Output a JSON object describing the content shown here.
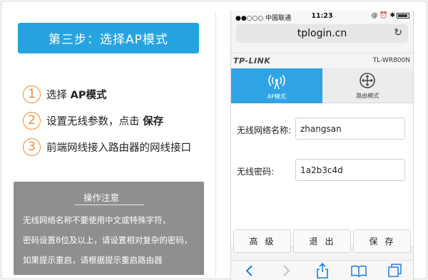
{
  "left": {
    "step_title": "第三步：选择AP模式",
    "steps": [
      {
        "num": "1",
        "text": "选择 ",
        "bold": "AP模式"
      },
      {
        "num": "2",
        "text": "设置无线参数，点击 ",
        "bold": "保存"
      },
      {
        "num": "3",
        "text": "前端网线接入路由器的网线接口",
        "bold": ""
      }
    ],
    "notice": {
      "title": "操作注意",
      "lines": [
        "无线网络名称不要使用中文或特殊字符，",
        "密码设置8位及以上，请设置相对复杂的密码，",
        "如果提示重启，请根据提示重启路由器"
      ]
    }
  },
  "phone": {
    "status": {
      "carrier": "●●○○○ 中国联通",
      "time": "11:23",
      "right": "@ ⏰ ✱"
    },
    "url": "tplogin.cn",
    "brand": "TP-LINK",
    "model": "TL-WR800N",
    "modes": [
      {
        "label": "AP模式",
        "icon": "wifi-signal-icon",
        "active": true
      },
      {
        "label": "路由模式",
        "icon": "router-mode-icon",
        "active": false
      }
    ],
    "fields": [
      {
        "label": "无线网络名称:",
        "value": "zhangsan"
      },
      {
        "label": "无线密码:",
        "value": "1a2b3c4d"
      }
    ],
    "buttons": [
      "高级",
      "退出",
      "保存"
    ]
  },
  "colors": {
    "accent": "#27a4e0",
    "step_orange": "#ef8a2c",
    "notice_bg": "#8f8f8f"
  }
}
